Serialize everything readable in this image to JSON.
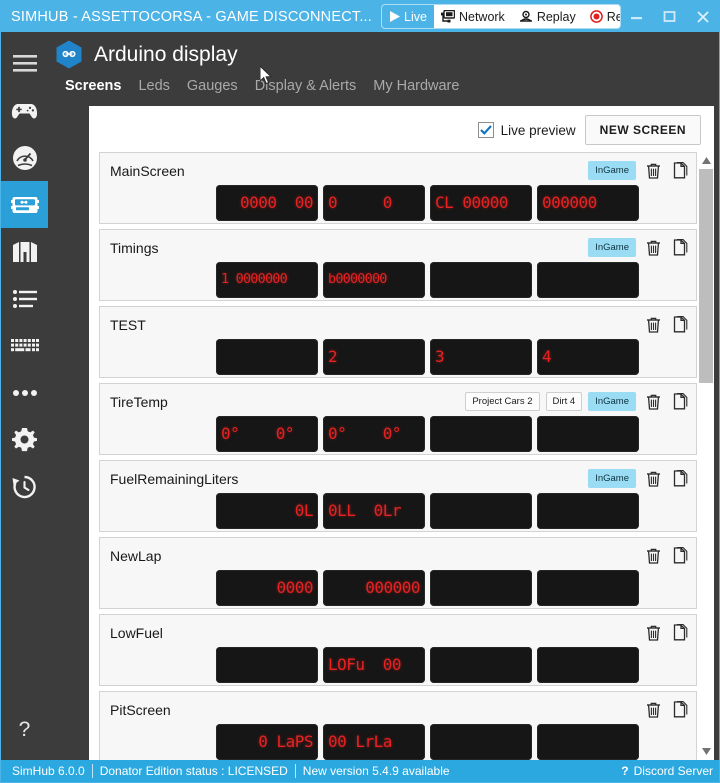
{
  "window": {
    "title": "SIMHUB - ASSETTOCORSA - GAME DISCONNECT...",
    "modes": [
      {
        "label": "Live",
        "icon": "play-icon",
        "active": true
      },
      {
        "label": "Network",
        "icon": "network-icon",
        "active": false
      },
      {
        "label": "Replay",
        "icon": "replay-icon",
        "active": false
      },
      {
        "label": "Record",
        "icon": "record-icon",
        "active": false
      }
    ],
    "controls": {
      "minimize": "minimize-icon",
      "maximize": "maximize-icon",
      "close": "close-icon"
    }
  },
  "sidebar": {
    "menu_icon": "hamburger-icon",
    "items": [
      {
        "name": "games",
        "icon": "gamepad-icon",
        "active": false
      },
      {
        "name": "dash-studio",
        "icon": "gauge-icon",
        "active": false
      },
      {
        "name": "arduino",
        "icon": "arduino-board-icon",
        "active": true
      },
      {
        "name": "overlays",
        "icon": "overlay-icon",
        "active": false
      },
      {
        "name": "lists",
        "icon": "list-icon",
        "active": false
      },
      {
        "name": "keyboard",
        "icon": "keyboard-icon",
        "active": false
      },
      {
        "name": "more",
        "icon": "ellipsis-icon",
        "active": false
      },
      {
        "name": "settings",
        "icon": "gear-icon",
        "active": false
      },
      {
        "name": "history",
        "icon": "history-icon",
        "active": false
      }
    ],
    "help_label": "?"
  },
  "page": {
    "icon": "arduino-hex-icon",
    "title": "Arduino display",
    "tabs": [
      {
        "label": "Screens",
        "active": true
      },
      {
        "label": "Leds",
        "active": false
      },
      {
        "label": "Gauges",
        "active": false
      },
      {
        "label": "Display & Alerts",
        "active": false
      },
      {
        "label": "My Hardware",
        "active": false
      }
    ]
  },
  "toolbar": {
    "live_preview_label": "Live preview",
    "live_preview_checked": true,
    "new_screen_label": "NEW SCREEN"
  },
  "screens": [
    {
      "name": "MainScreen",
      "tags": [
        "InGame"
      ],
      "lcds": [
        {
          "text": "0000  00",
          "align": "right"
        },
        {
          "text": "0     0",
          "align": "left"
        },
        {
          "text": "CL 00000",
          "align": "left"
        },
        {
          "text": "000000",
          "align": "left"
        }
      ]
    },
    {
      "name": "Timings",
      "tags": [
        "InGame"
      ],
      "lcds": [
        {
          "text": "1 0000000",
          "align": "left",
          "small": true
        },
        {
          "text": "b0000000",
          "align": "left",
          "small": true
        },
        {
          "text": "",
          "align": "left"
        },
        {
          "text": "",
          "align": "left"
        }
      ]
    },
    {
      "name": "TEST",
      "tags": [],
      "lcds": [
        {
          "text": "",
          "align": "left"
        },
        {
          "text": "2",
          "align": "left"
        },
        {
          "text": "3",
          "align": "left"
        },
        {
          "text": "4",
          "align": "left"
        }
      ]
    },
    {
      "name": "TireTemp",
      "tags": [
        "Project Cars 2",
        "Dirt 4",
        "InGame"
      ],
      "lcds": [
        {
          "text": "0°    0°",
          "align": "left"
        },
        {
          "text": "0°    0°",
          "align": "left"
        },
        {
          "text": "",
          "align": "left"
        },
        {
          "text": "",
          "align": "left"
        }
      ]
    },
    {
      "name": "FuelRemainingLiters",
      "tags": [
        "InGame"
      ],
      "lcds": [
        {
          "text": "0L",
          "align": "right"
        },
        {
          "text": "0LL  0Lr",
          "align": "left"
        },
        {
          "text": "",
          "align": "left"
        },
        {
          "text": "",
          "align": "left"
        }
      ]
    },
    {
      "name": "NewLap",
      "tags": [],
      "lcds": [
        {
          "text": "0000",
          "align": "right"
        },
        {
          "text": "000000",
          "align": "right"
        },
        {
          "text": "",
          "align": "left"
        },
        {
          "text": "",
          "align": "left"
        }
      ]
    },
    {
      "name": "LowFuel",
      "tags": [],
      "lcds": [
        {
          "text": "",
          "align": "left"
        },
        {
          "text": "LOFu  00",
          "align": "left"
        },
        {
          "text": "",
          "align": "left"
        },
        {
          "text": "",
          "align": "left"
        }
      ]
    },
    {
      "name": "PitScreen",
      "tags": [],
      "lcds": [
        {
          "text": "0 LaPS",
          "align": "right"
        },
        {
          "text": "00 LrLa",
          "align": "left"
        },
        {
          "text": "",
          "align": "left"
        },
        {
          "text": "",
          "align": "left"
        }
      ]
    }
  ],
  "row_actions": {
    "delete_icon": "trash-icon",
    "duplicate_icon": "copy-icon"
  },
  "scrollbar": {
    "up_icon": "chevron-up-icon",
    "down_icon": "chevron-down-icon"
  },
  "statusbar": {
    "version": "SimHub 6.0.0",
    "donator": "Donator Edition status :  LICENSED",
    "update": "New version 5.4.9 available",
    "discord": "Discord Server",
    "discord_icon": "question-icon"
  },
  "colors": {
    "accent": "#4bb3e6",
    "status_bar": "#2ba8e0",
    "sidebar": "#3c3c3c",
    "lcd_bg": "#161616",
    "lcd_text": "#e62222",
    "tag_ingame": "#9adcf3"
  }
}
